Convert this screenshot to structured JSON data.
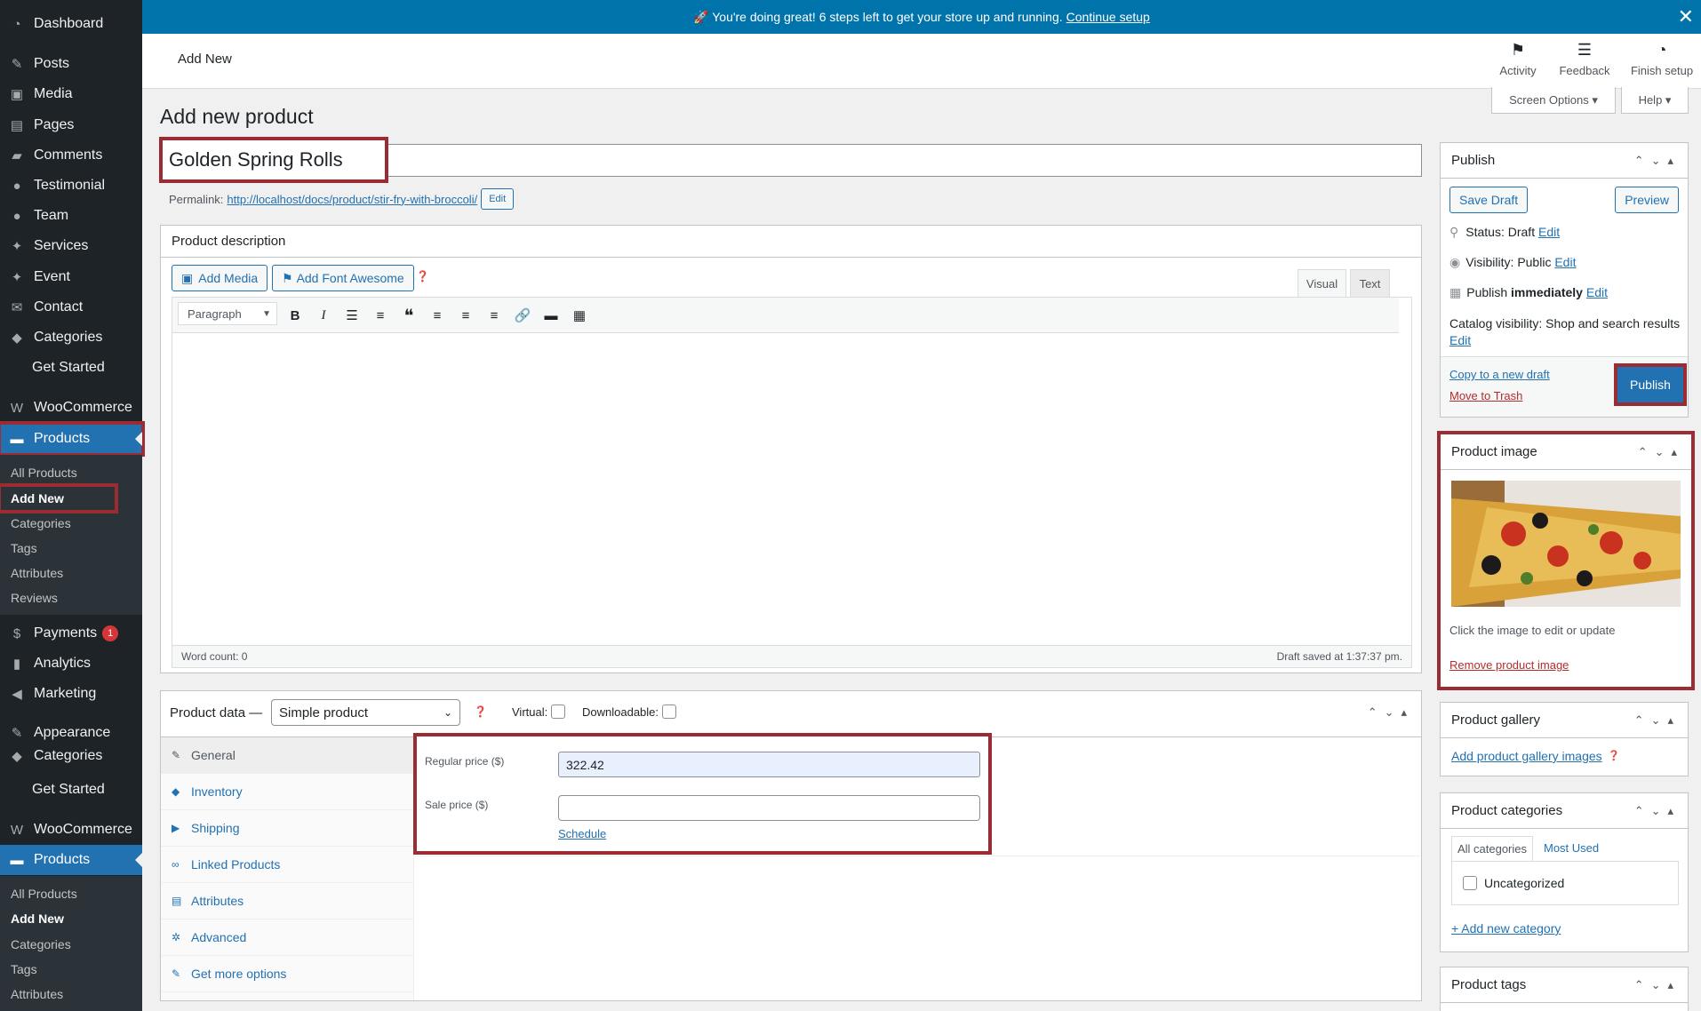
{
  "notice": {
    "text": "🚀 You're doing great! 6 steps left to get your store up and running.",
    "link": "Continue setup"
  },
  "topbar": {
    "breadcrumb": "Add New",
    "activity": "Activity",
    "feedback": "Feedback",
    "finish_setup": "Finish setup",
    "screen_options": "Screen Options ▾",
    "help": "Help ▾"
  },
  "sidebar": {
    "dashboard": "Dashboard",
    "posts": "Posts",
    "media": "Media",
    "pages": "Pages",
    "comments": "Comments",
    "testimonial": "Testimonial",
    "team": "Team",
    "services": "Services",
    "event": "Event",
    "contact": "Contact",
    "categories": "Categories",
    "get_started": "Get Started",
    "woocommerce": "WooCommerce",
    "products": "Products",
    "sub_all_products": "All Products",
    "sub_add_new": "Add New",
    "sub_categories": "Categories",
    "sub_tags": "Tags",
    "sub_attributes": "Attributes",
    "sub_reviews": "Reviews",
    "payments": "Payments",
    "payments_badge": "1",
    "analytics": "Analytics",
    "marketing": "Marketing",
    "appearance": "Appearance",
    "categories_clipped": "Categories",
    "get_started_2": "Get Started",
    "woocommerce_2": "WooCommerce",
    "products_2": "Products",
    "sub2_all_products": "All Products",
    "sub2_add_new": "Add New",
    "sub2_categories": "Categories",
    "sub2_tags": "Tags",
    "sub2_attributes": "Attributes"
  },
  "page": {
    "title": "Add new product",
    "product_name": "Golden Spring Rolls",
    "permalink_label": "Permalink:",
    "permalink_url": "http://localhost/docs/product/stir-fry-with-broccoli/",
    "permalink_edit": "Edit"
  },
  "editor": {
    "box_title": "Product description",
    "add_media": "Add Media",
    "add_font_awesome": "Add Font Awesome",
    "tab_visual": "Visual",
    "tab_text": "Text",
    "format_select": "Paragraph",
    "word_count": "Word count: 0",
    "draft_saved": "Draft saved at 1:37:37 pm."
  },
  "product_data": {
    "label": "Product data —",
    "type_select": "Simple product",
    "virtual": "Virtual:",
    "downloadable": "Downloadable:",
    "tabs": [
      "General",
      "Inventory",
      "Shipping",
      "Linked Products",
      "Attributes",
      "Advanced",
      "Get more options"
    ],
    "regular_price_label": "Regular price ($)",
    "regular_price": "322.42",
    "sale_price_label": "Sale price ($)",
    "sale_price": "",
    "schedule": "Schedule"
  },
  "publish": {
    "title": "Publish",
    "save_draft": "Save Draft",
    "preview": "Preview",
    "status_label": "Status:",
    "status_value": "Draft",
    "visibility_label": "Visibility:",
    "visibility_value": "Public",
    "publish_label": "Publish",
    "publish_value": "immediately",
    "edit": "Edit",
    "catalog_visibility": "Catalog visibility: Shop and search results",
    "copy_draft": "Copy to a new draft",
    "move_trash": "Move to Trash",
    "publish_button": "Publish"
  },
  "product_image": {
    "title": "Product image",
    "hint": "Click the image to edit or update",
    "remove": "Remove product image"
  },
  "gallery": {
    "title": "Product gallery",
    "add": "Add product gallery images"
  },
  "categories_box": {
    "title": "Product categories",
    "tab_all": "All categories",
    "tab_most": "Most Used",
    "item": "Uncategorized",
    "add_new": "+ Add new category"
  },
  "tags_box": {
    "title": "Product tags"
  },
  "colors": {
    "admin_blue": "#2271b1",
    "sidebar_bg": "#1d2327",
    "highlight": "#9b2c34",
    "notice": "#0073aa"
  }
}
